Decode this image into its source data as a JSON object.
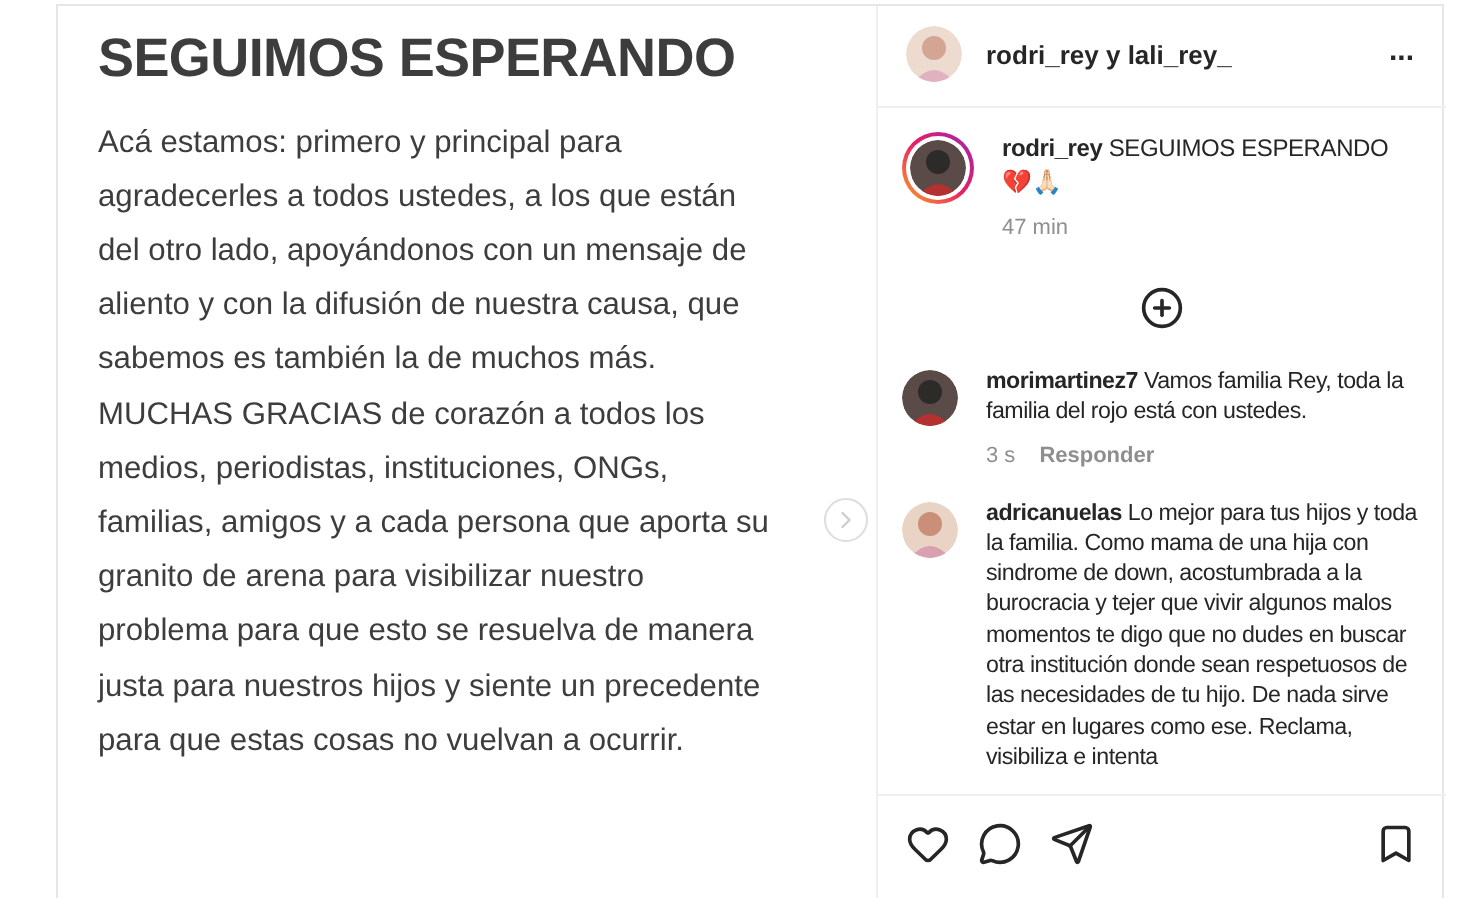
{
  "post_image": {
    "title": "SEGUIMOS ESPERANDO",
    "body_lines": [
      "Acá estamos: primero y principal para",
      "agradecerles a todos ustedes, a los que están",
      "del otro lado, apoyándonos con un mensaje de",
      "aliento y con la difusión de nuestra causa, que",
      "sabemos es también la de muchos más.",
      "MUCHAS GRACIAS de corazón a todos los",
      "medios, periodistas, instituciones, ONGs,",
      "familias, amigos y a cada persona que aporta su",
      "granito de arena para visibilizar nuestro",
      "problema para que esto se resuelva de manera",
      "justa para nuestros hijos y siente un precedente",
      "para que estas cosas no vuelvan a ocurrir."
    ]
  },
  "header": {
    "authors": "rodri_rey y lali_rey_",
    "menu": "..."
  },
  "caption": {
    "username": "rodri_rey",
    "text": "SEGUIMOS ESPERANDO",
    "emoji": "💔🙏🏻",
    "time": "47 min"
  },
  "comments": [
    {
      "username": "morimartinez7",
      "text": "Vamos familia Rey, toda la familia del rojo está con ustedes.",
      "time": "3 s",
      "reply": "Responder"
    },
    {
      "username": "adricanuelas",
      "text": "Lo mejor para tus hijos y toda la familia. Como mama de una hija con sindrome de down, acostumbrada a la burocracia y tejer que vivir algunos malos momentos te digo que no dudes en buscar otra institución donde sean respetuosos de las necesidades de tu hijo. De nada sirve estar en lugares como ese. Reclama, visibiliza e intenta"
    }
  ]
}
